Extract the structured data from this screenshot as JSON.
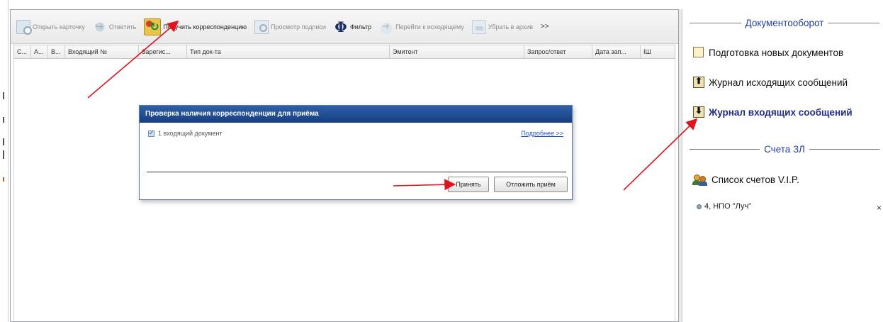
{
  "toolbar": {
    "buttons": [
      {
        "label": "Открыть карточку",
        "icon": "card-icon",
        "enabled": false
      },
      {
        "label": "Ответить",
        "icon": "reply-icon",
        "enabled": false
      },
      {
        "label": "Получить корреспонденцию",
        "icon": "get-mail-icon",
        "enabled": true
      },
      {
        "label": "Просмотр подписи",
        "icon": "signature-icon",
        "enabled": false
      },
      {
        "label": "Фильтр",
        "icon": "phi-filter-icon",
        "enabled": true
      },
      {
        "label": "Перейти к исходящему",
        "icon": "goto-icon",
        "enabled": false
      },
      {
        "label": "Убрать в архив",
        "icon": "archive-icon",
        "enabled": false
      }
    ],
    "more_label": ">>"
  },
  "grid": {
    "columns": [
      "С...",
      "А...",
      "В...",
      "Входящий №",
      "Зарегис...",
      "Тип док-та",
      "Эмитент",
      "Запрос/ответ",
      "Дата зап...",
      "ІШ"
    ]
  },
  "dialog": {
    "title": "Проверка наличия корреспонденции для приёма",
    "item_label": "1 входящий документ",
    "item_checked": true,
    "details_link": "Подробнее >>",
    "accept_label": "Принять",
    "postpone_label": "Отложить приём"
  },
  "sidebar": {
    "section_docflow": "Документооборот",
    "items": [
      {
        "label": "Подготовка новых документов",
        "icon": "new-doc-icon"
      },
      {
        "label": "Журнал исходящих сообщений",
        "icon": "outgoing-icon"
      },
      {
        "label": "Журнал входящих сообщений",
        "icon": "incoming-icon",
        "active": true
      }
    ],
    "section_accounts": "Счета ЗЛ",
    "vip_label": "Список счетов V.I.P.",
    "sub_item": "4, НПО \"Луч\"",
    "close_glyph": "×"
  },
  "colors": {
    "accent_blue": "#2641a3",
    "dialog_title_bg": "#163f82",
    "annotation_arrow": "#e0141e"
  }
}
